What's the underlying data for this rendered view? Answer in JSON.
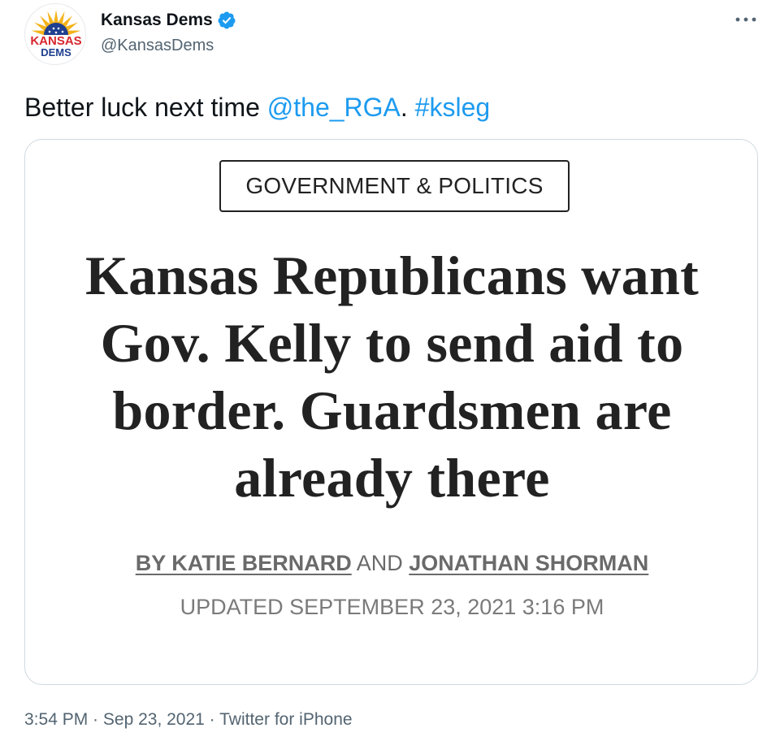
{
  "author": {
    "display_name": "Kansas Dems",
    "handle": "@KansasDems",
    "avatar_text": {
      "line1": "KANSAS",
      "line2": "DEMS"
    },
    "verified_icon": "verified-badge-icon"
  },
  "tweet": {
    "text_prefix": "Better luck next time ",
    "mention": "@the_RGA",
    "text_middle": ". ",
    "hashtag": "#ksleg"
  },
  "card": {
    "category": "GOVERNMENT & POLITICS",
    "headline_lines": [
      "Kansas Republicans want",
      "Gov. Kelly to send aid to",
      "border. Guardsmen are",
      "already there"
    ],
    "byline": {
      "author1": "BY KATIE BERNARD",
      "conjunction": " AND ",
      "author2": "JONATHAN SHORMAN"
    },
    "updated": "UPDATED SEPTEMBER 23, 2021 3:16 PM"
  },
  "meta": {
    "time": "3:54 PM",
    "separator": " · ",
    "date": "Sep 23, 2021",
    "source": "Twitter for iPhone"
  },
  "colors": {
    "link": "#1d9bf0",
    "secondary_text": "#536471",
    "card_border": "#cfd9de",
    "brand_red": "#d7262e",
    "brand_blue": "#1f3f8f",
    "sunflower": "#f4b31a"
  },
  "more_icon": "more-horizontal-icon"
}
